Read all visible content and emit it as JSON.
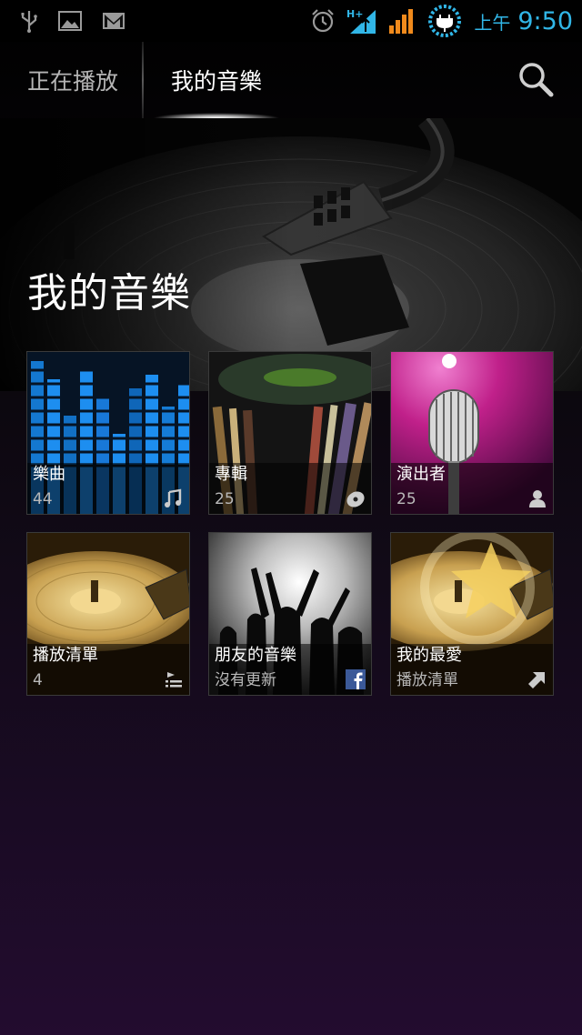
{
  "status_bar": {
    "icons_left": [
      "usb-icon",
      "image-icon",
      "gmail-icon"
    ],
    "icons_right": [
      "alarm-icon",
      "signal-hplus-icon",
      "signal-bars-icon",
      "charging-icon"
    ],
    "ampm": "上午",
    "time": "9:50",
    "time_color": "#31b6e7"
  },
  "tabs": {
    "now_playing": "正在播放",
    "my_music": "我的音樂"
  },
  "hero": {
    "title": "我的音樂"
  },
  "tiles": [
    {
      "title": "樂曲",
      "sub": "44",
      "icon": "music-note-icon"
    },
    {
      "title": "專輯",
      "sub": "25",
      "icon": "disc-icon"
    },
    {
      "title": "演出者",
      "sub": "25",
      "icon": "person-icon"
    },
    {
      "title": "播放清單",
      "sub": "4",
      "icon": "playlist-icon"
    },
    {
      "title": "朋友的音樂",
      "sub": "沒有更新",
      "icon": "facebook-icon"
    },
    {
      "title": "我的最愛",
      "sub": "播放清單",
      "icon": "shortcut-icon"
    }
  ]
}
